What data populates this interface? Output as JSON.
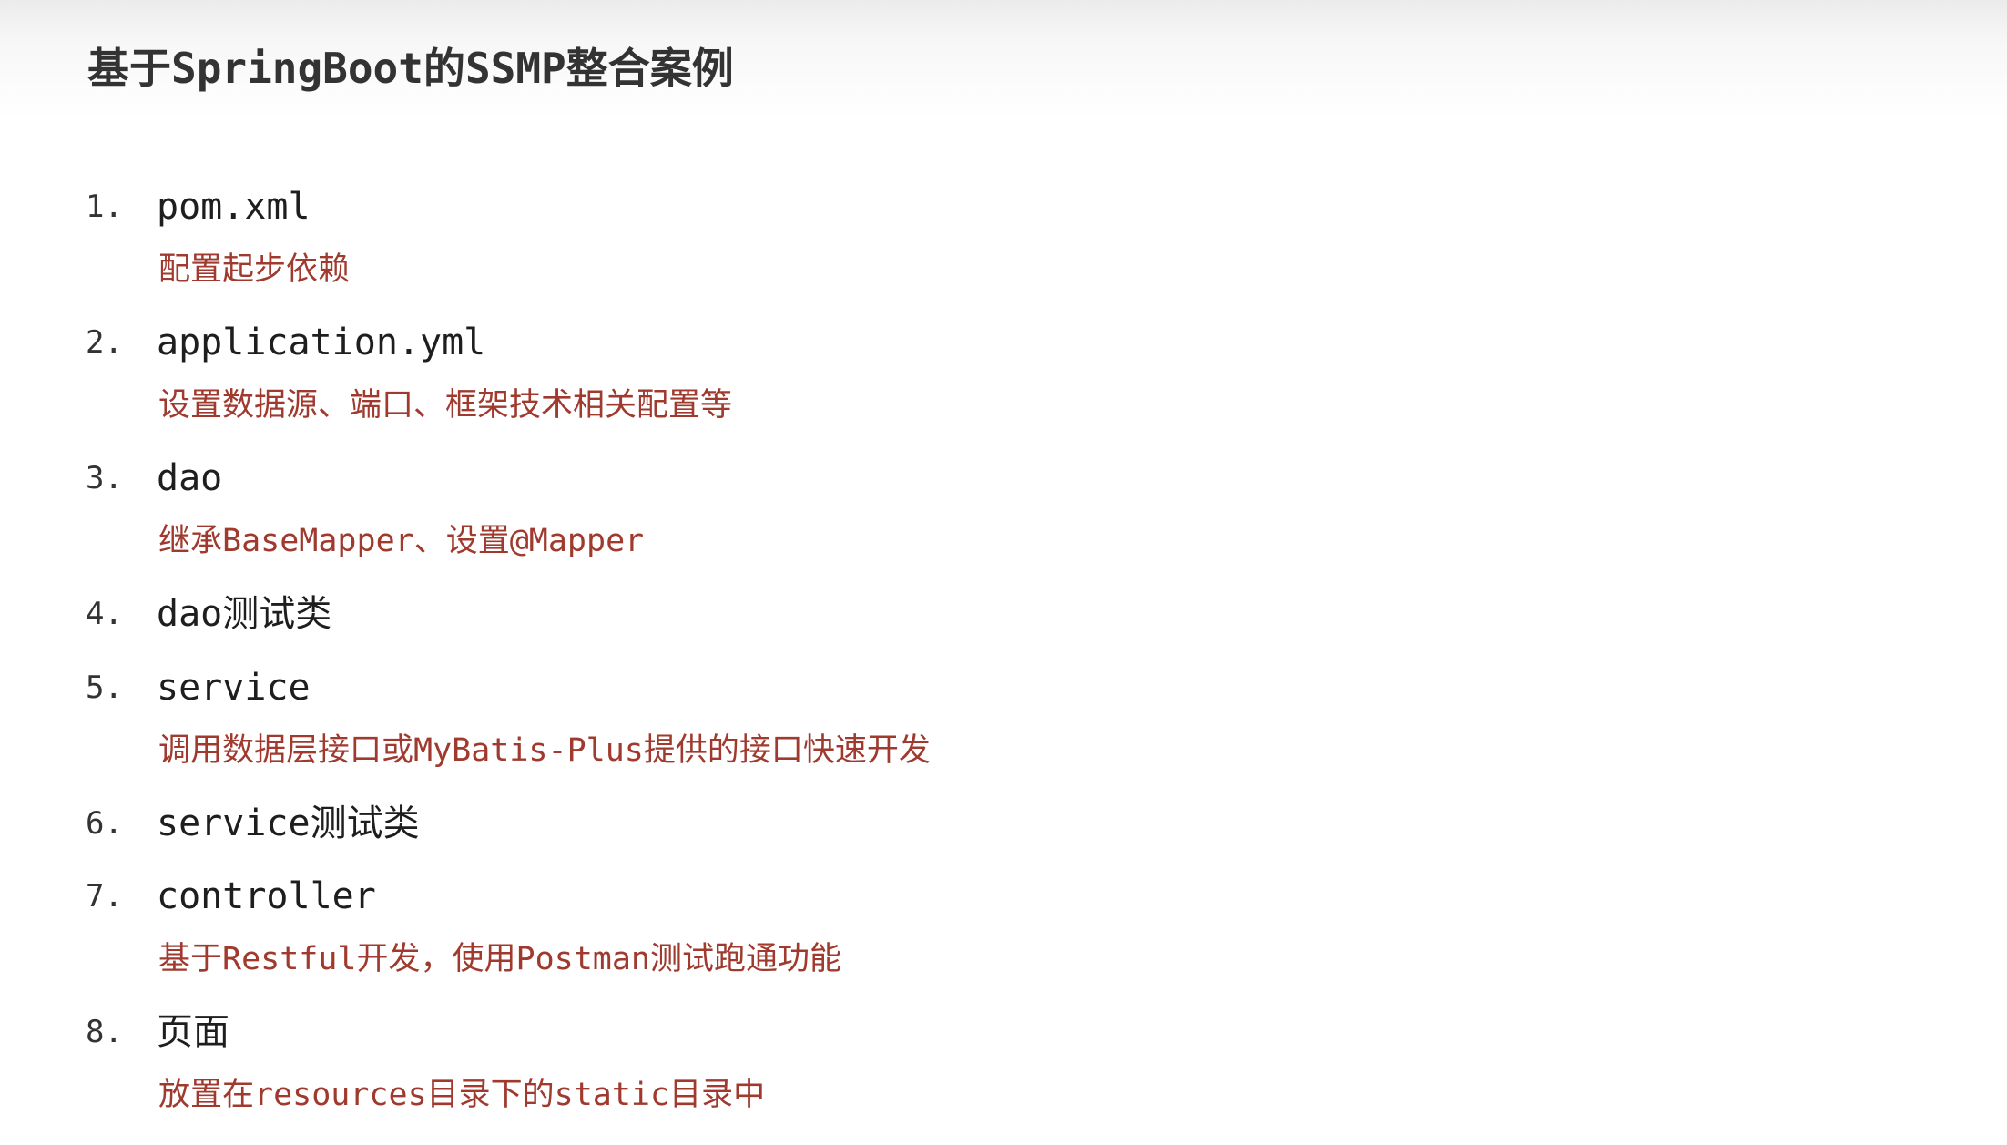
{
  "title": "基于SpringBoot的SSMP整合案例",
  "colors": {
    "title": "#333333",
    "item": "#1e1e1e",
    "description": "#a03a2e"
  },
  "items": [
    {
      "number": "1.",
      "label": "pom.xml",
      "description": "配置起步依赖"
    },
    {
      "number": "2.",
      "label": "application.yml",
      "description": "设置数据源、端口、框架技术相关配置等"
    },
    {
      "number": "3.",
      "label": "dao",
      "description": "继承BaseMapper、设置@Mapper"
    },
    {
      "number": "4.",
      "label": "dao测试类",
      "description": ""
    },
    {
      "number": "5.",
      "label": "service",
      "description": "调用数据层接口或MyBatis-Plus提供的接口快速开发"
    },
    {
      "number": "6.",
      "label": "service测试类",
      "description": ""
    },
    {
      "number": "7.",
      "label": "controller",
      "description": "基于Restful开发，使用Postman测试跑通功能"
    },
    {
      "number": "8.",
      "label": "页面",
      "description": "放置在resources目录下的static目录中"
    }
  ]
}
